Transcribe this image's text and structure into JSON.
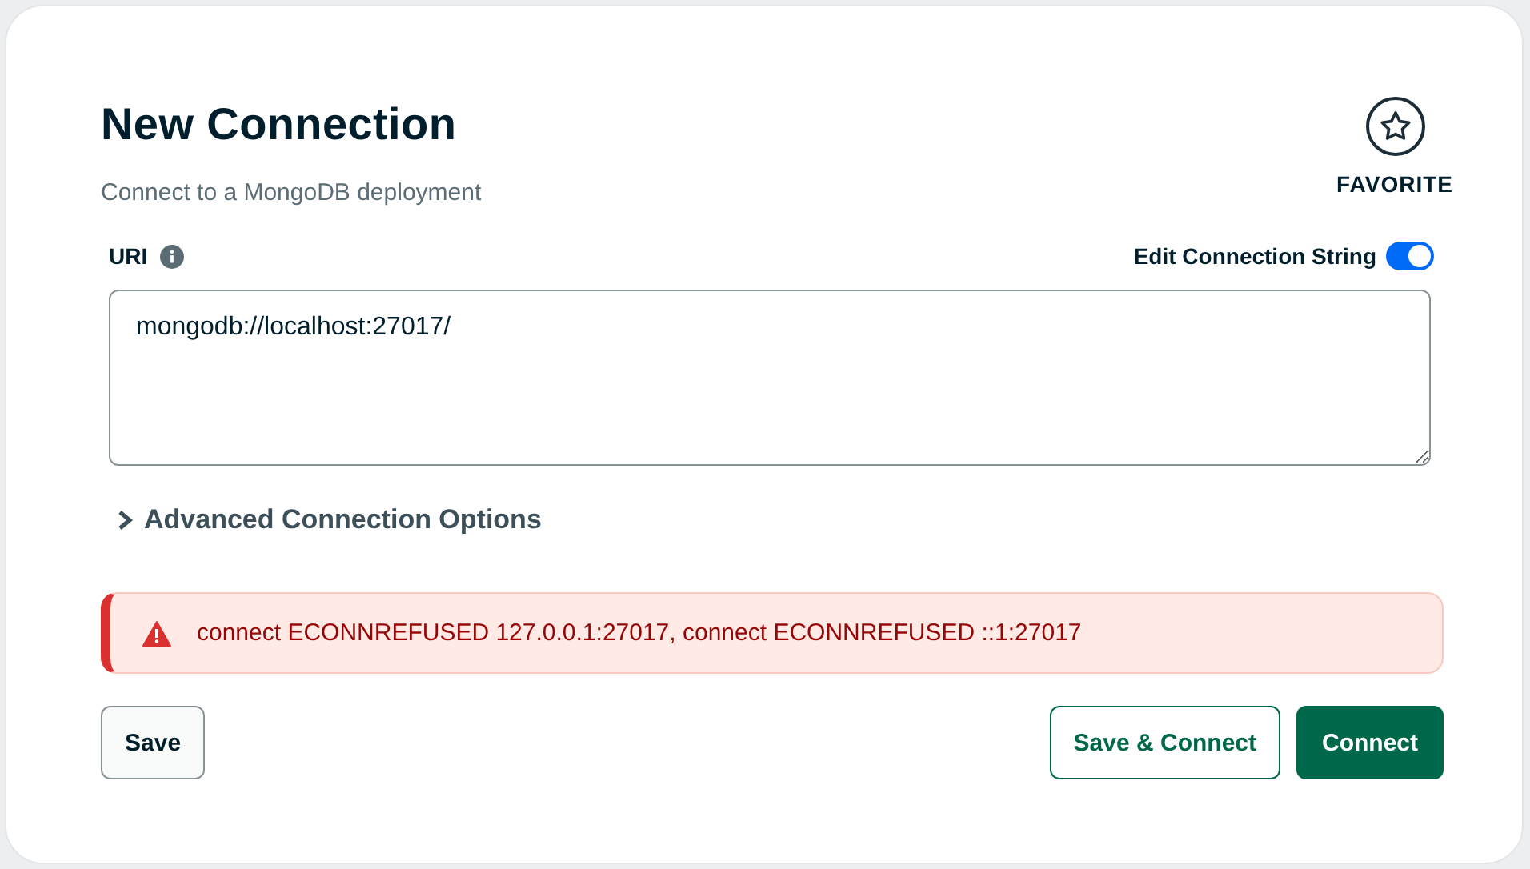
{
  "header": {
    "title": "New Connection",
    "subtitle": "Connect to a MongoDB deployment"
  },
  "favorite": {
    "label": "FAVORITE",
    "selected": false
  },
  "uri": {
    "label": "URI",
    "value": "mongodb://localhost:27017/"
  },
  "edit_connection_string": {
    "label": "Edit Connection String",
    "on": true
  },
  "advanced": {
    "label": "Advanced Connection Options",
    "expanded": false
  },
  "error": {
    "message": "connect ECONNREFUSED 127.0.0.1:27017, connect ECONNREFUSED ::1:27017"
  },
  "buttons": [
    {
      "label": "Save",
      "kind": "secondary"
    },
    {
      "label": "Save & Connect",
      "kind": "outline"
    },
    {
      "label": "Connect",
      "kind": "primary"
    }
  ]
}
